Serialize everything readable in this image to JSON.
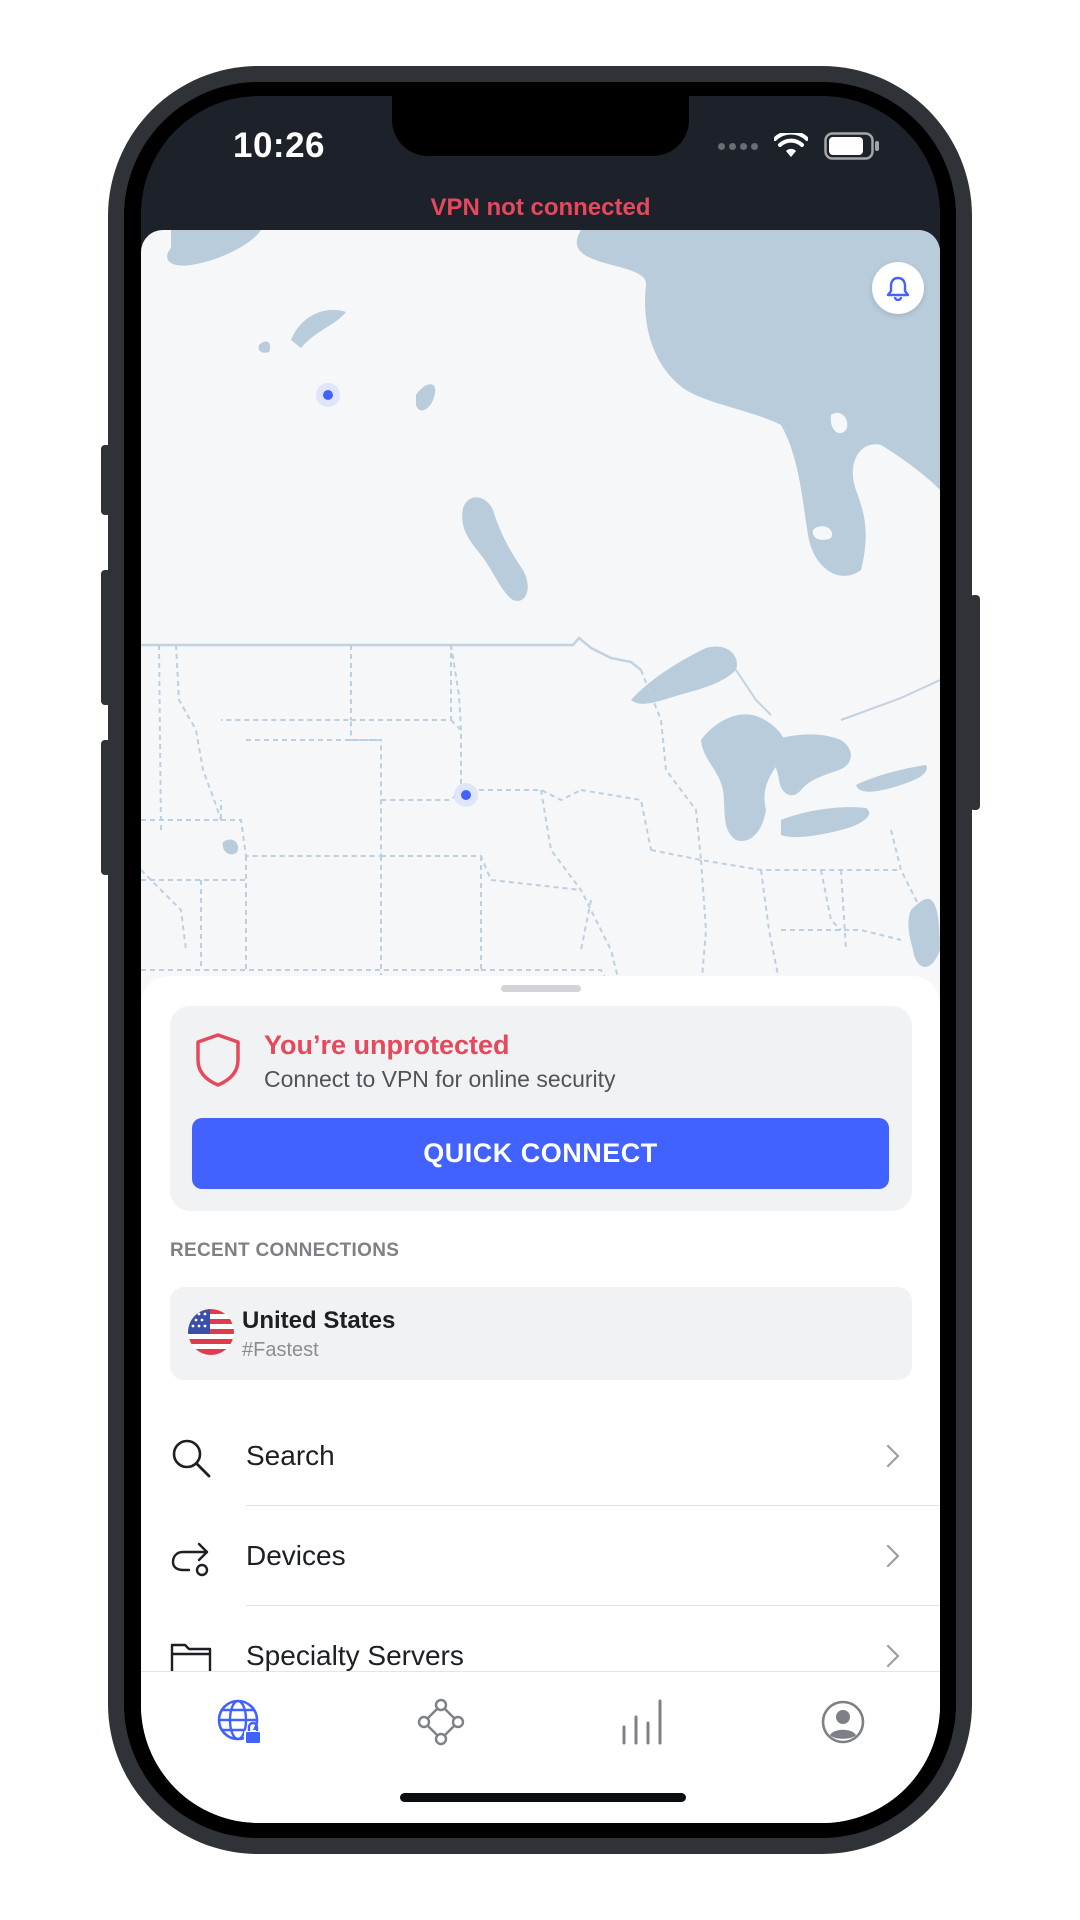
{
  "status_bar": {
    "time": "10:26"
  },
  "connection_status": "VPN not connected",
  "protection_card": {
    "title": "You’re unprotected",
    "subtitle": "Connect to VPN for online security",
    "button_label": "QUICK CONNECT"
  },
  "recent": {
    "heading": "RECENT CONNECTIONS",
    "items": [
      {
        "country": "United States",
        "tag": "#Fastest",
        "flag_icon": "us-flag-icon"
      }
    ]
  },
  "menu": [
    {
      "label": "Search",
      "icon": "search-icon"
    },
    {
      "label": "Devices",
      "icon": "devices-icon"
    },
    {
      "label": "Specialty Servers",
      "icon": "folder-icon"
    }
  ],
  "tabs": [
    {
      "name": "vpn-globe",
      "icon": "globe-lock-icon",
      "active": true
    },
    {
      "name": "meshnet",
      "icon": "meshnet-icon",
      "active": false
    },
    {
      "name": "stats",
      "icon": "bars-icon",
      "active": false
    },
    {
      "name": "profile",
      "icon": "profile-icon",
      "active": false
    }
  ],
  "colors": {
    "accent": "#4262ff",
    "danger": "#e6485c",
    "water": "#b9ccdb",
    "land": "#f6f7f8",
    "dark_header": "#1d2129"
  }
}
